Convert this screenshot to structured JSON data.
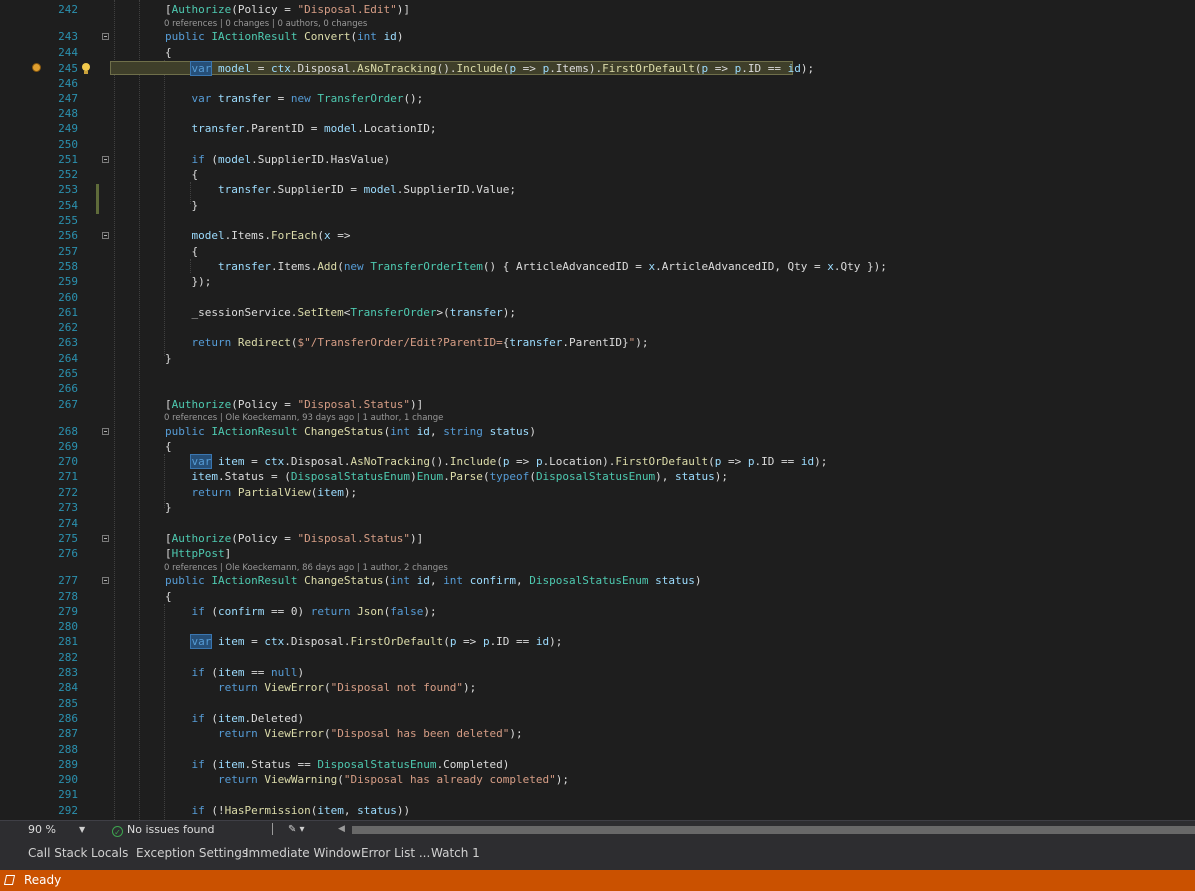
{
  "editor": {
    "lens": {
      "l242": "0 references | 0 changes | 0 authors, 0 changes",
      "l267": "0 references | Ole Koeckemann, 93 days ago | 1 author, 1 change",
      "l276": "0 references | Ole Koeckemann, 86 days ago | 1 author, 2 changes"
    }
  },
  "statusstrip": {
    "zoom": "90 %",
    "issues": "No issues found"
  },
  "tool_tabs": [
    "Call Stack",
    "Locals",
    "Exception Settings",
    "Immediate Window",
    "Error List ...",
    "Watch 1"
  ],
  "status": {
    "text": "Ready"
  },
  "colors": {
    "statusbar": "#ca5100",
    "editor_bg": "#1e1e1e",
    "line_numbers": "#2b91af",
    "keyword": "#569cd6",
    "type": "#4ec9b0",
    "string": "#d69d85"
  }
}
